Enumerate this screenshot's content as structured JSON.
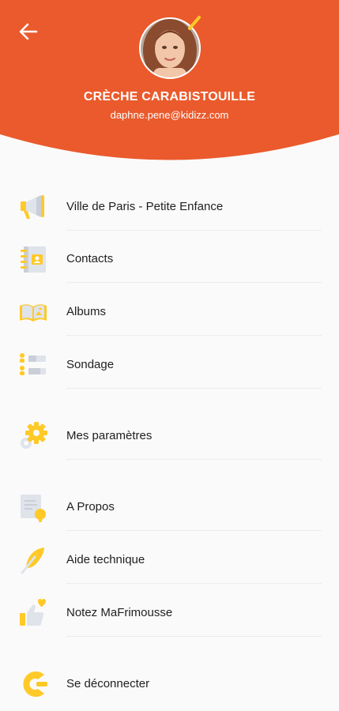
{
  "header": {
    "background_color": "#EA5A2C",
    "org_name": "CRÈCHE CARABISTOUILLE",
    "email": "daphne.pene@kidizz.com",
    "back_icon": "arrow-left-icon",
    "avatar_icon": "user-avatar"
  },
  "accent_color": "#FFC928",
  "menu": [
    {
      "label": "Ville de Paris - Petite Enfance",
      "icon": "megaphone-icon"
    },
    {
      "label": "Contacts",
      "icon": "address-book-icon"
    },
    {
      "label": "Albums",
      "icon": "photo-album-icon"
    },
    {
      "label": "Sondage",
      "icon": "poll-icon"
    },
    {
      "label": "Mes paramètres",
      "icon": "settings-gear-icon"
    },
    {
      "label": "A Propos",
      "icon": "about-icon"
    },
    {
      "label": "Aide technique",
      "icon": "feather-icon"
    },
    {
      "label": "Notez MaFrimousse",
      "icon": "thumbs-up-heart-icon"
    },
    {
      "label": "Se déconnecter",
      "icon": "logout-icon"
    }
  ]
}
